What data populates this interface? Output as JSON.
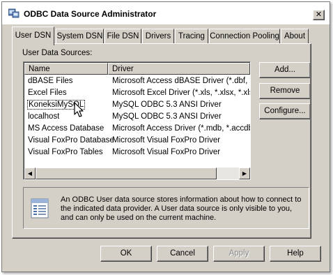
{
  "window": {
    "title": "ODBC Data Source Administrator",
    "close_glyph": "✕"
  },
  "tabs": [
    {
      "label": "User DSN",
      "active": true
    },
    {
      "label": "System DSN",
      "active": false
    },
    {
      "label": "File DSN",
      "active": false
    },
    {
      "label": "Drivers",
      "active": false
    },
    {
      "label": "Tracing",
      "active": false
    },
    {
      "label": "Connection Pooling",
      "active": false
    },
    {
      "label": "About",
      "active": false
    }
  ],
  "section_label": "User Data Sources:",
  "list": {
    "columns": [
      "Name",
      "Driver"
    ],
    "rows": [
      {
        "name": "dBASE Files",
        "driver": "Microsoft Access dBASE Driver (*.dbf, *.nd"
      },
      {
        "name": "Excel Files",
        "driver": "Microsoft Excel Driver (*.xls, *.xlsx, *.xlsm,"
      },
      {
        "name": "KoneksiMySQL",
        "driver": "MySQL ODBC 5.3 ANSI Driver",
        "selected": true
      },
      {
        "name": "localhost",
        "driver": "MySQL ODBC 5.3 ANSI Driver"
      },
      {
        "name": "MS Access Database",
        "driver": "Microsoft Access Driver (*.mdb, *.accdb)"
      },
      {
        "name": "Visual FoxPro Database",
        "driver": "Microsoft Visual FoxPro Driver"
      },
      {
        "name": "Visual FoxPro Tables",
        "driver": "Microsoft Visual FoxPro Driver"
      }
    ],
    "scroll_left_glyph": "◀",
    "scroll_right_glyph": "▶"
  },
  "side_buttons": {
    "add": "Add...",
    "remove": "Remove",
    "configure": "Configure..."
  },
  "info": {
    "line1": "An ODBC User data source stores information about how to connect to",
    "line2": "the indicated data provider.   A User data source is only visible to you,",
    "line3": "and can only be used on the current machine.",
    "icon": "data-source-icon"
  },
  "bottom_buttons": {
    "ok": "OK",
    "cancel": "Cancel",
    "apply": "Apply",
    "help": "Help"
  },
  "colors": {
    "dialog_bg": "#d4d0c8",
    "title_bg": "#ffffff",
    "disabled_text": "#8a8a8a"
  }
}
